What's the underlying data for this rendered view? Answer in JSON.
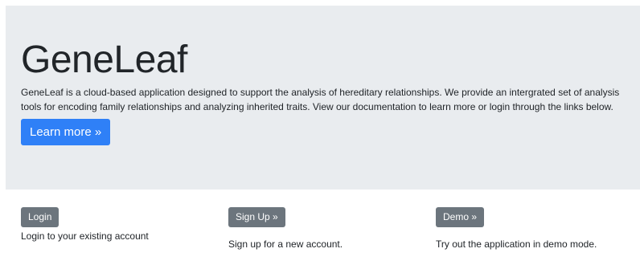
{
  "hero": {
    "title": "GeneLeaf",
    "description": "GeneLeaf is a cloud-based application designed to support the analysis of hereditary relationships. We provide an intergrated set of analysis tools for encoding family relationships and analyzing inherited traits. View our documentation to learn more or login through the links below.",
    "learn_more_label": "Learn more »"
  },
  "actions": {
    "login": {
      "button_label": "Login",
      "text": "Login to your existing account"
    },
    "signup": {
      "button_label": "Sign Up »",
      "text": "Sign up for a new account."
    },
    "demo": {
      "button_label": "Demo »",
      "text": "Try out the application in demo mode."
    }
  },
  "colors": {
    "hero_background": "#e9ecef",
    "primary": "#2f80f7",
    "secondary": "#6c757d"
  }
}
